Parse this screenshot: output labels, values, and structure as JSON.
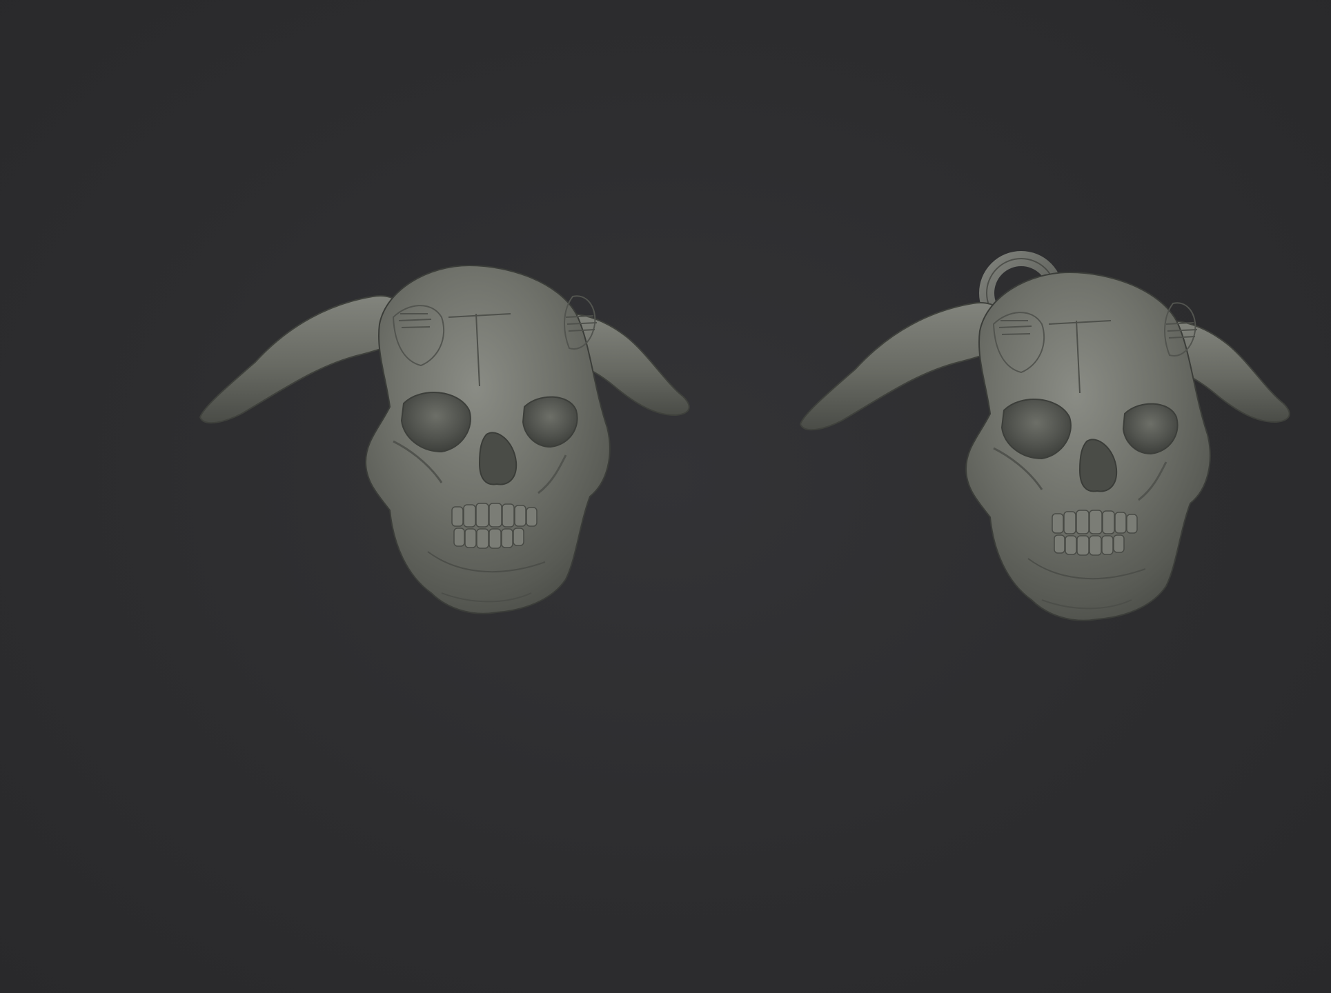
{
  "scene": {
    "background_color": "#2e2e30",
    "material_color": "#6e7069",
    "models": [
      {
        "name": "horned-skull",
        "variant": "without-bail"
      },
      {
        "name": "horned-skull-pendant",
        "variant": "with-bail"
      }
    ]
  }
}
